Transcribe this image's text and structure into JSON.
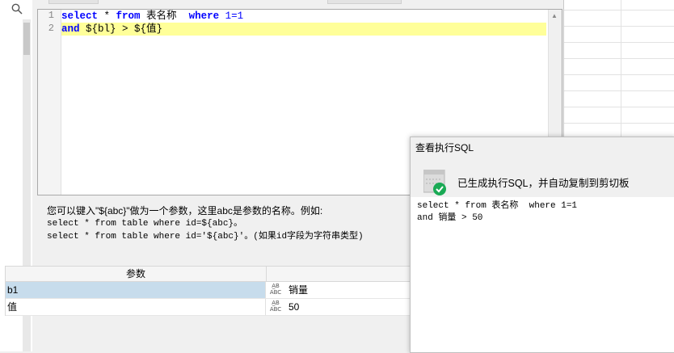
{
  "editor": {
    "lines": [
      {
        "num": "1"
      },
      {
        "num": "2"
      }
    ],
    "line1": {
      "kw1": "select",
      "star": " * ",
      "kw2": "from",
      "table": " 表名称  ",
      "kw3": "where",
      "cond": " 1=1"
    },
    "line2": {
      "kw1": "and",
      "rest": " ${bl} > ${值}"
    }
  },
  "hint": {
    "line1": "您可以键入\"${abc}\"做为一个参数，这里abc是参数的名称。例如:",
    "line2": "select * from table where id=${abc}。",
    "line3": "select * from table where id='${abc}'。(如果id字段为字符串类型)"
  },
  "params_grid": {
    "header": "参数",
    "rows": [
      {
        "name": "b1",
        "type": "ABC",
        "value": "销量"
      },
      {
        "name": "值",
        "type": "ABC",
        "value": "50"
      }
    ]
  },
  "dialog": {
    "title": "查看执行SQL",
    "message": "已生成执行SQL，并自动复制到剪切板",
    "sql_line1": "select * from 表名称  where 1=1",
    "sql_line2": "and 销量 > 50"
  },
  "colors": {
    "keyword": "#0000ff",
    "highlight_line": "#ffff99",
    "selected_row": "#c7dcec",
    "success_check": "#1aaa55"
  },
  "icons": {
    "search": "search-icon",
    "type": "abc-type-icon",
    "dialog": "database-success-icon"
  }
}
